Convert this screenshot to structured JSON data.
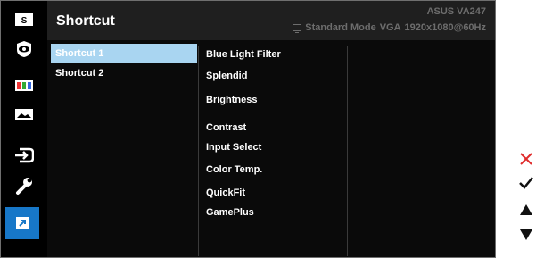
{
  "header": {
    "title": "Shortcut",
    "model": "ASUS  VA247",
    "mode": "Standard Mode",
    "input": "VGA",
    "resolution": "1920x1080@60Hz"
  },
  "menu": {
    "left_items": [
      "Shortcut 1",
      "Shortcut 2"
    ],
    "options": [
      "Blue Light Filter",
      "Splendid",
      "Brightness",
      "Contrast",
      "Input Select",
      "Color Temp.",
      "QuickFit",
      "GamePlus"
    ]
  },
  "icons": [
    "splendid-icon",
    "eye-care-icon",
    "color-icon",
    "image-icon",
    "input-select-icon",
    "system-setup-icon",
    "shortcut-icon"
  ],
  "nav_keys": [
    "close-icon",
    "check-icon",
    "up-arrow-icon",
    "down-arrow-icon"
  ],
  "colors": {
    "accent": "#1777c8",
    "selected": "#a9d5f1",
    "close": "#e02b2b"
  }
}
